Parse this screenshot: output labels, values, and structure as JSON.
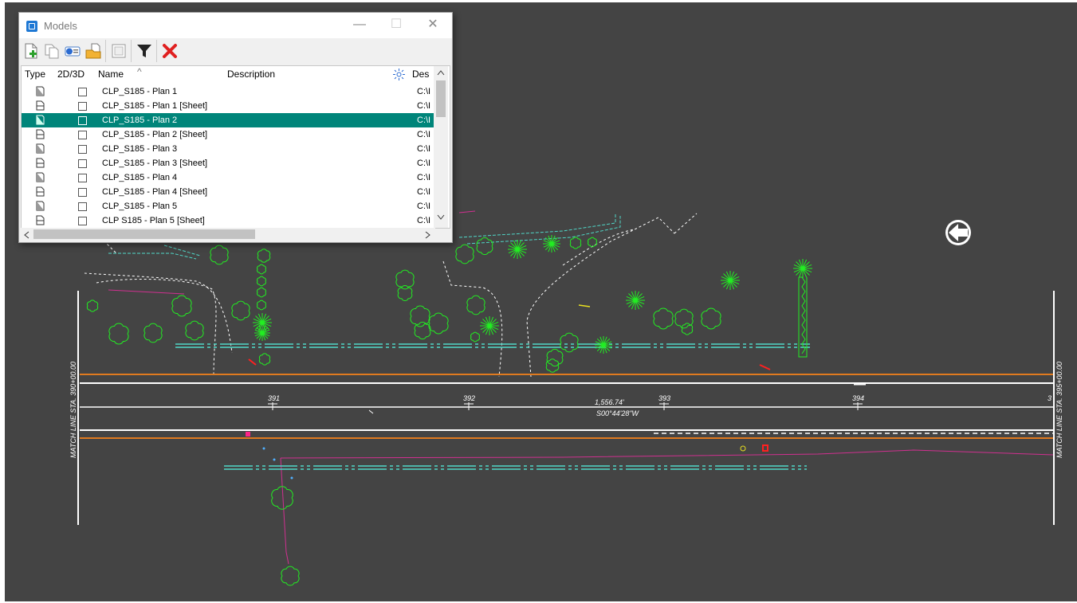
{
  "dialog": {
    "title": "Models",
    "minimize_glyph": "—",
    "maximize_glyph": "☐",
    "close_glyph": "✕",
    "toolbar": [
      "new-model-icon",
      "copy-model-icon",
      "model-properties-icon",
      "import-model-icon",
      "blank-icon",
      "filter-icon",
      "delete-icon"
    ],
    "columns": {
      "type": "Type",
      "dim": "2D/3D",
      "name": "Name",
      "description": "Description",
      "file": "Des"
    },
    "sort_indicator": "^",
    "rows": [
      {
        "type": "design",
        "name": "CLP_S185 - Plan 1",
        "path": "C:\\I"
      },
      {
        "type": "sheet",
        "name": "CLP_S185 - Plan 1 [Sheet]",
        "path": "C:\\I"
      },
      {
        "type": "design",
        "name": "CLP_S185 - Plan 2",
        "path": "C:\\I",
        "selected": true
      },
      {
        "type": "sheet",
        "name": "CLP_S185 - Plan 2 [Sheet]",
        "path": "C:\\I"
      },
      {
        "type": "design",
        "name": "CLP_S185 - Plan 3",
        "path": "C:\\I"
      },
      {
        "type": "sheet",
        "name": "CLP_S185 - Plan 3 [Sheet]",
        "path": "C:\\I"
      },
      {
        "type": "design",
        "name": "CLP_S185 - Plan 4",
        "path": "C:\\I"
      },
      {
        "type": "sheet",
        "name": "CLP_S185 - Plan 4 [Sheet]",
        "path": "C:\\I"
      },
      {
        "type": "design",
        "name": "CLP_S185 - Plan 5",
        "path": "C:\\I"
      },
      {
        "type": "sheet",
        "name": "CLP S185 - Plan 5 [Sheet]",
        "path": "C:\\I"
      }
    ],
    "selected_color": "#00857a"
  },
  "drawing": {
    "background": "#444444",
    "station_labels": [
      "391",
      "392",
      "393",
      "394",
      "3"
    ],
    "bearing_distance": "1,556.74'",
    "bearing": "S00°44'28\"W",
    "match_line_left": "MATCH LINE STA. 390+00.00",
    "match_line_right": "MATCH LINE STA. 395+00.00",
    "colors": {
      "edge_line": "#e07a1f",
      "utility_line": "#50d8c8",
      "fence": "#d03090",
      "trees": "#22ee22",
      "centerline": "#ffffff"
    }
  }
}
